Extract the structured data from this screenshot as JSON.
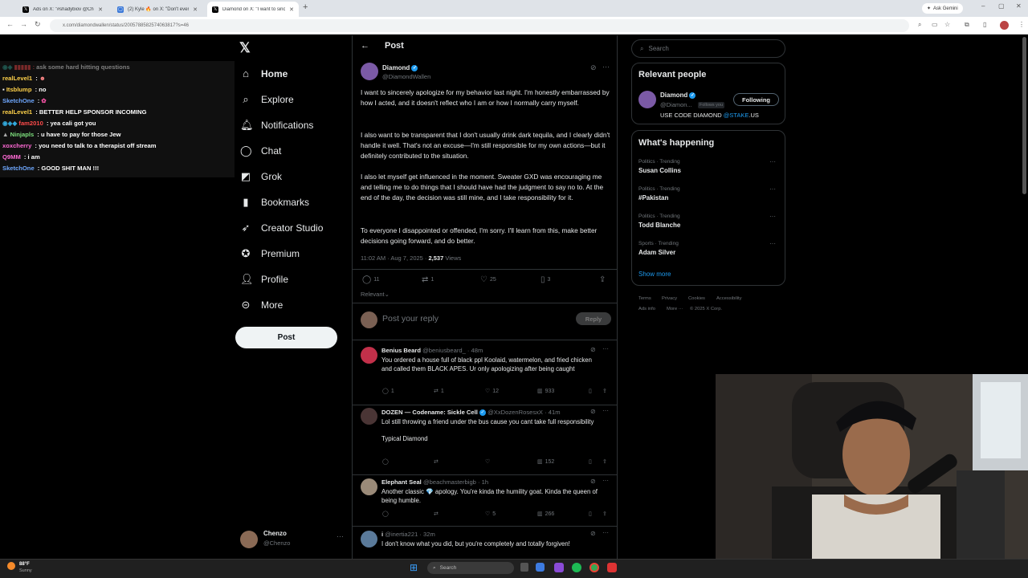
{
  "browser": {
    "tabs": [
      {
        "title": "Ads on X: \"#shadybiov @Che"
      },
      {
        "title": "(2) Kyle 🔥 on X: \"Don't ever tr"
      },
      {
        "title": "Diamond on X: \"I want to since"
      }
    ],
    "url": "x.com/diamondwallen/status/2005788582574063817?s=46",
    "gemini": "Ask Gemini"
  },
  "chat": [
    {
      "user": "kromethius",
      "msg": "ask some hard hitting questions",
      "color": "#888888"
    },
    {
      "user": "realLevel1",
      "msg": "",
      "color": "#ffd24a"
    },
    {
      "user": "Itsblump",
      "msg": "no",
      "color": "#ffd24a"
    },
    {
      "user": "SketchOne",
      "msg": "",
      "color": "#6fa8ff"
    },
    {
      "user": "realLevel1",
      "msg": "BETTER HELP SPONSOR INCOMING",
      "color": "#ffd24a"
    },
    {
      "user": "fam2010",
      "msg": "yea cali got you",
      "color": "#ff4b4b"
    },
    {
      "user": "Ninjapls",
      "msg": "u have to pay for those Jew",
      "color": "#7ee07e"
    },
    {
      "user": "xoxcherry",
      "msg": "you need to talk to a therapist off stream",
      "color": "#ff6ad5"
    },
    {
      "user": "Q9MM",
      "msg": "i am",
      "color": "#ff6ad5"
    },
    {
      "user": "SketchOne",
      "msg": "GOOD SHIT MAN !!!",
      "color": "#6fa8ff"
    }
  ],
  "nav": {
    "items": [
      "Home",
      "Explore",
      "Notifications",
      "Chat",
      "Grok",
      "Bookmarks",
      "Creator Studio",
      "Premium",
      "Profile",
      "More"
    ],
    "post": "Post",
    "account": {
      "name": "Chenzo",
      "handle": "@Chenzo"
    }
  },
  "post": {
    "header": "Post",
    "author": {
      "name": "Diamond",
      "handle": "@DiamondWallen"
    },
    "paragraphs": [
      "I want to sincerely apologize for my behavior last night. I'm honestly embarrassed by how I acted, and it doesn't reflect who I am or how I normally carry myself.",
      "I also want to be transparent that I don't usually drink dark tequila, and I clearly didn't handle it well. That's not an excuse—I'm still responsible for my own actions—but it definitely contributed to the situation.",
      "I also let myself get influenced in the moment. Sweater GXD was encouraging me and telling me to do things that I should have had the judgment to say no to. At the end of the day, the decision was still mine, and I take responsibility for it.",
      "To everyone I disappointed or offended, I'm sorry. I'll learn from this, make better decisions going forward, and do better."
    ],
    "timestamp": "11:02 AM · Aug 7, 2025 · ",
    "views": "2,537",
    "views_label": " Views",
    "stats": {
      "replies": "11",
      "reposts": "1",
      "likes": "25",
      "bookmarks": "3"
    },
    "sort": "Relevant",
    "reply_placeholder": "Post your reply",
    "reply_button": "Reply"
  },
  "replies": [
    {
      "name": "Benius Beard",
      "handle": "@beniusbeard_ · 48m",
      "text": "You ordered a house full of black ppl Koolaid, watermelon, and fried chicken and called them BLACK APES. Ur only apologizing after being caught",
      "replies": "1",
      "reposts": "1",
      "likes": "12",
      "views": "933"
    },
    {
      "name": "DOZEN — Codename: Sickle Cell",
      "handle": "@XxDozenRosesxX · 41m",
      "text": "Lol still throwing a friend under the bus cause you cant take full responsibility\n\nTypical Diamond",
      "replies": "",
      "reposts": "",
      "likes": "",
      "views": "152"
    },
    {
      "name": "Elephant Seal",
      "handle": "@beachmasterbigb · 1h",
      "text": "Another classic 💎 apology. You're kinda the humility goat. Kinda the queen of being humble.",
      "replies": "",
      "reposts": "",
      "likes": "5",
      "views": "266"
    },
    {
      "name": "i",
      "handle": "@inertia221 · 32m",
      "text": "I don't know what you did, but you're completely and totally forgiven!",
      "replies": "",
      "reposts": "",
      "likes": "",
      "views": ""
    }
  ],
  "sidebar": {
    "search_placeholder": "Search",
    "relevant_title": "Relevant people",
    "person": {
      "name": "Diamond",
      "handle": "@Diamon...",
      "follows_you": "Follows you",
      "bio_prefix": "USE CODE DIAMOND ",
      "bio_link": "@STAKE",
      "bio_suffix": ".US",
      "button": "Following"
    },
    "happening_title": "What's happening",
    "trends": [
      {
        "category": "Politics · Trending",
        "name": "Susan Collins"
      },
      {
        "category": "Politics · Trending",
        "name": "#Pakistan"
      },
      {
        "category": "Politics · Trending",
        "name": "Todd Blanche"
      },
      {
        "category": "Sports · Trending",
        "name": "Adam Silver"
      }
    ],
    "show_more": "Show more",
    "footer": [
      "Terms",
      "Privacy",
      "Cookies",
      "Accessibility",
      "Ads info",
      "More ···",
      "© 2025 X Corp."
    ]
  },
  "taskbar": {
    "weather_temp": "88°F",
    "weather_desc": "Sunny",
    "search": "Search"
  }
}
